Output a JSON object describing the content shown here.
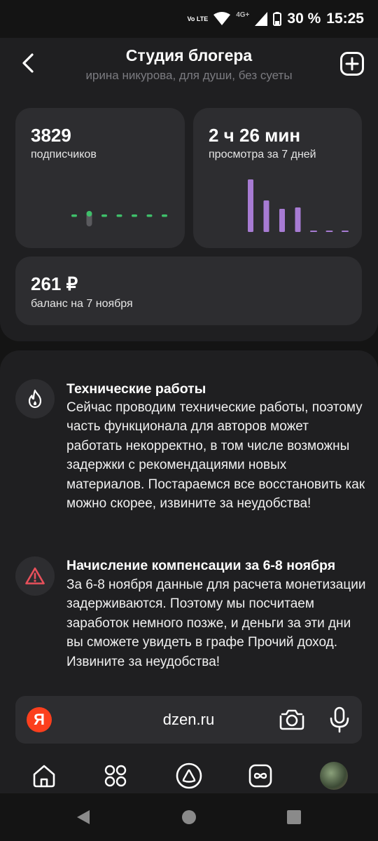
{
  "status_bar": {
    "battery": "30 %",
    "time": "15:25",
    "network": "4G+",
    "volte": "Vo LTE"
  },
  "header": {
    "title": "Студия блогера",
    "subtitle": "ирина никурова, для души, без суеты"
  },
  "stats": {
    "subscribers": {
      "value": "3829",
      "label": "подписчиков"
    },
    "views": {
      "value": "2 ч 26 мин",
      "label": "просмотра за 7 дней"
    },
    "balance": {
      "value": "261 ₽",
      "label": "баланс на 7 ноября"
    }
  },
  "notices": [
    {
      "title": "Технические работы",
      "body": "Сейчас проводим технические работы, поэтому часть функционала для авторов может работать некорректно, в том числе возможны задержки с рекомендациями новых материалов. Постараемся все восстановить как можно скорее, извините за неудобства!",
      "icon": "flame-icon"
    },
    {
      "title": "Начисление компенсации за 6-8 ноября",
      "body": "За 6-8 ноября данные для расчета монетизации задерживаются. Поэтому мы посчитаем заработок немного позже, и деньги за эти дни вы сможете увидеть в графе Прочий доход. Извините за неудобства!",
      "icon": "warning-icon"
    }
  ],
  "browser": {
    "url": "dzen.ru",
    "logo_letter": "Я"
  },
  "chart_data": [
    {
      "type": "bar",
      "series": [
        {
          "values": [
            0,
            1,
            0,
            0,
            0,
            0,
            0
          ]
        }
      ],
      "colors": [
        "#3fbf6a",
        "#5a5a5e"
      ]
    },
    {
      "type": "bar",
      "series": [
        {
          "values": [
            75,
            45,
            33,
            35,
            1,
            1,
            1
          ]
        }
      ],
      "colors": [
        "#a77bd3"
      ]
    }
  ],
  "colors": {
    "background": "#141414",
    "panel": "#1f1f21",
    "card": "#2d2d30",
    "accent_purple": "#a77bd3",
    "accent_green": "#3fbf6a",
    "yandex_red": "#fc3f1d"
  },
  "icons": [
    "back-arrow-icon",
    "plus-icon",
    "flame-icon",
    "warning-icon",
    "camera-icon",
    "microphone-icon",
    "home-icon",
    "grid-icon",
    "alice-icon",
    "infinity-icon",
    "avatar"
  ]
}
